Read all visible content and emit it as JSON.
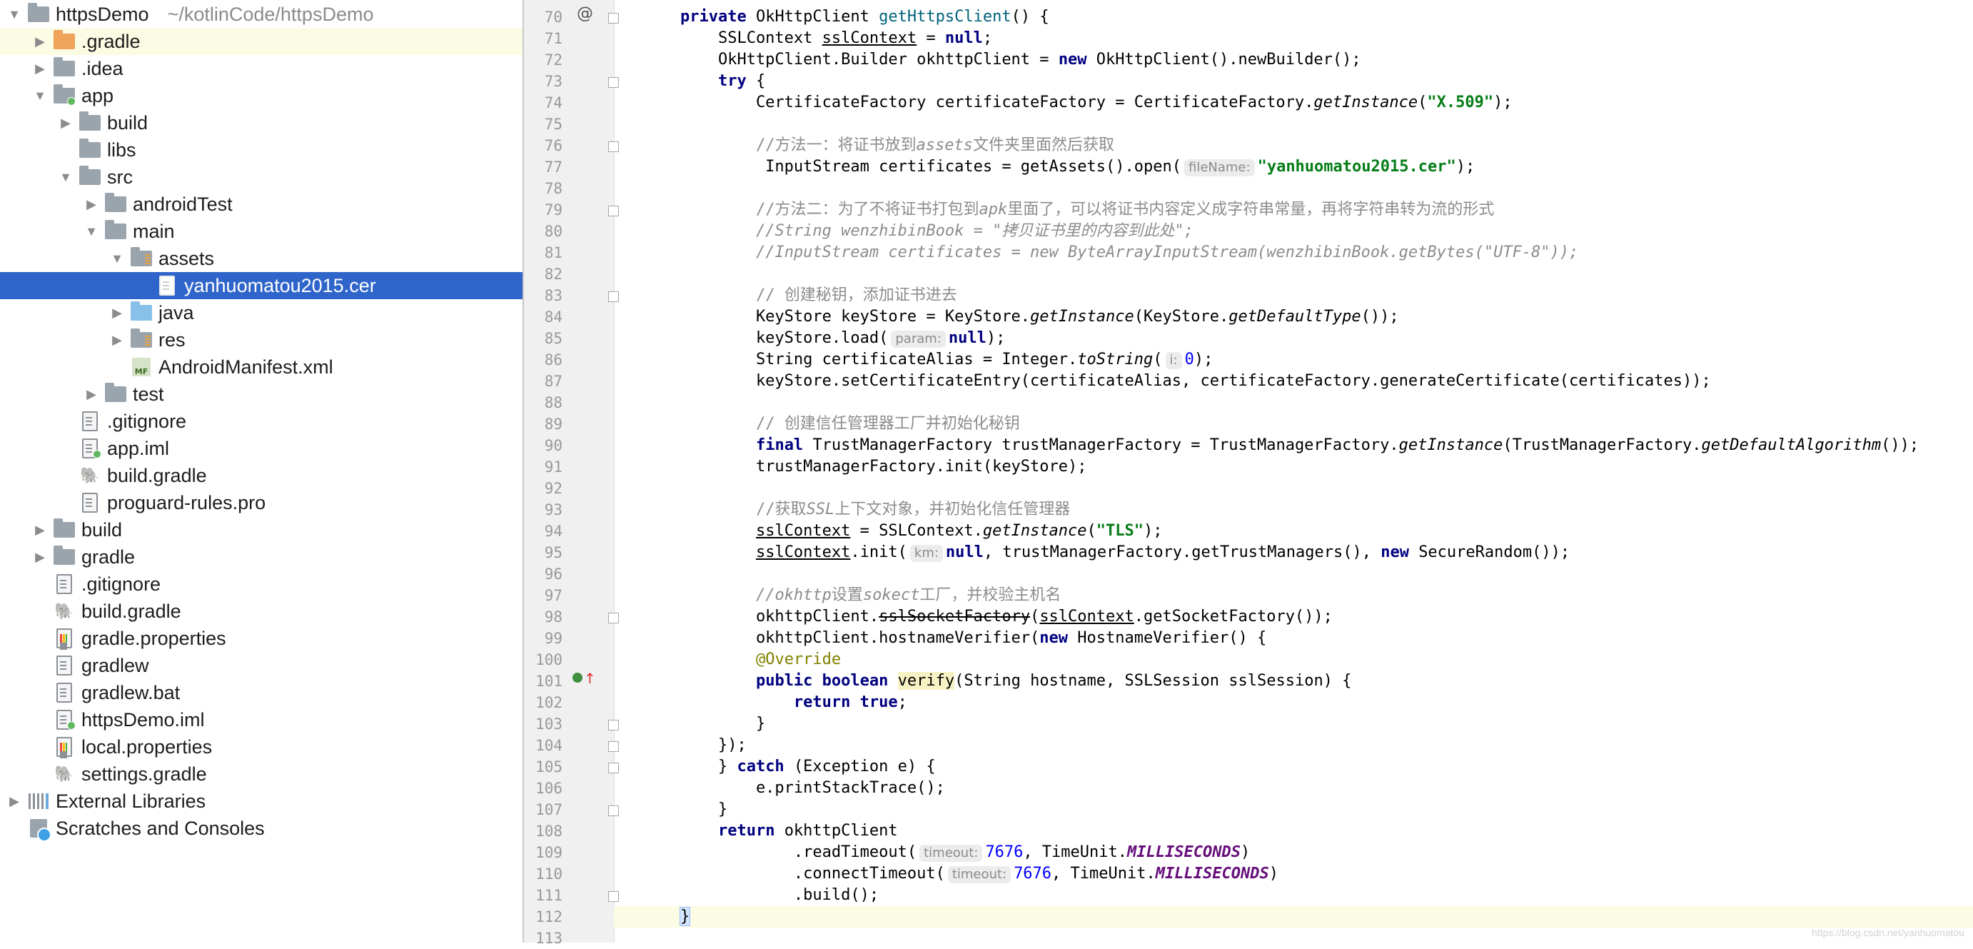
{
  "project": {
    "name": "httpsDemo",
    "path": "~/kotlinCode/httpsDemo"
  },
  "tree": [
    {
      "label": "httpsDemo",
      "indent": 0,
      "arrow": "down",
      "icon": "folder",
      "state": "project-root"
    },
    {
      "label": ".gradle",
      "indent": 1,
      "arrow": "right",
      "icon": "folder-orange",
      "state": "highlight"
    },
    {
      "label": ".idea",
      "indent": 1,
      "arrow": "right",
      "icon": "folder"
    },
    {
      "label": "app",
      "indent": 1,
      "arrow": "down",
      "icon": "module-folder"
    },
    {
      "label": "build",
      "indent": 2,
      "arrow": "right",
      "icon": "folder"
    },
    {
      "label": "libs",
      "indent": 2,
      "arrow": "",
      "icon": "folder"
    },
    {
      "label": "src",
      "indent": 2,
      "arrow": "down",
      "icon": "folder"
    },
    {
      "label": "androidTest",
      "indent": 3,
      "arrow": "right",
      "icon": "folder"
    },
    {
      "label": "main",
      "indent": 3,
      "arrow": "down",
      "icon": "folder"
    },
    {
      "label": "assets",
      "indent": 4,
      "arrow": "down",
      "icon": "folder-res"
    },
    {
      "label": "yanhuomatou2015.cer",
      "indent": 5,
      "arrow": "",
      "icon": "file-white",
      "state": "selected"
    },
    {
      "label": "java",
      "indent": 4,
      "arrow": "right",
      "icon": "folder-blue"
    },
    {
      "label": "res",
      "indent": 4,
      "arrow": "right",
      "icon": "folder-res"
    },
    {
      "label": "AndroidManifest.xml",
      "indent": 4,
      "arrow": "",
      "icon": "manifest"
    },
    {
      "label": "test",
      "indent": 3,
      "arrow": "right",
      "icon": "folder"
    },
    {
      "label": ".gitignore",
      "indent": 2,
      "arrow": "",
      "icon": "file"
    },
    {
      "label": "app.iml",
      "indent": 2,
      "arrow": "",
      "icon": "module-file"
    },
    {
      "label": "build.gradle",
      "indent": 2,
      "arrow": "",
      "icon": "gradle"
    },
    {
      "label": "proguard-rules.pro",
      "indent": 2,
      "arrow": "",
      "icon": "file"
    },
    {
      "label": "build",
      "indent": 1,
      "arrow": "right",
      "icon": "folder"
    },
    {
      "label": "gradle",
      "indent": 1,
      "arrow": "right",
      "icon": "folder"
    },
    {
      "label": ".gitignore",
      "indent": 1,
      "arrow": "",
      "icon": "file"
    },
    {
      "label": "build.gradle",
      "indent": 1,
      "arrow": "",
      "icon": "gradle"
    },
    {
      "label": "gradle.properties",
      "indent": 1,
      "arrow": "",
      "icon": "properties"
    },
    {
      "label": "gradlew",
      "indent": 1,
      "arrow": "",
      "icon": "file"
    },
    {
      "label": "gradlew.bat",
      "indent": 1,
      "arrow": "",
      "icon": "file"
    },
    {
      "label": "httpsDemo.iml",
      "indent": 1,
      "arrow": "",
      "icon": "module-file"
    },
    {
      "label": "local.properties",
      "indent": 1,
      "arrow": "",
      "icon": "properties"
    },
    {
      "label": "settings.gradle",
      "indent": 1,
      "arrow": "",
      "icon": "gradle"
    },
    {
      "label": "External Libraries",
      "indent": 0,
      "arrow": "right",
      "icon": "libraries"
    },
    {
      "label": "Scratches and Consoles",
      "indent": 0,
      "arrow": "",
      "icon": "scratches"
    }
  ],
  "editor": {
    "current_line": 112,
    "line_numbers": [
      "70",
      "71",
      "72",
      "73",
      "74",
      "75",
      "76",
      "77",
      "78",
      "79",
      "80",
      "81",
      "82",
      "83",
      "84",
      "85",
      "86",
      "87",
      "88",
      "89",
      "90",
      "91",
      "92",
      "93",
      "94",
      "95",
      "96",
      "97",
      "98",
      "99",
      "100",
      "101",
      "102",
      "103",
      "104",
      "105",
      "106",
      "107",
      "108",
      "109",
      "110",
      "111",
      "112",
      "113"
    ],
    "lines": [
      [
        [
          "    ",
          ""
        ],
        [
          "private ",
          "kw"
        ],
        [
          "OkHttpClient ",
          ""
        ],
        [
          "getHttpsClient",
          "fn"
        ],
        [
          "() {",
          ""
        ]
      ],
      [
        [
          "        SSLContext ",
          ""
        ],
        [
          "sslContext",
          "ul"
        ],
        [
          " = ",
          ""
        ],
        [
          "null",
          "kw"
        ],
        [
          ";",
          ""
        ]
      ],
      [
        [
          "        OkHttpClient.Builder ",
          ""
        ],
        [
          "okhttpClient",
          ""
        ],
        [
          " = ",
          ""
        ],
        [
          "new ",
          "kw"
        ],
        [
          "OkHttpClient().newBuilder();",
          ""
        ]
      ],
      [
        [
          "        ",
          ""
        ],
        [
          "try ",
          "kw"
        ],
        [
          "{",
          ""
        ]
      ],
      [
        [
          "            CertificateFactory certificateFactory = CertificateFactory.",
          ""
        ],
        [
          "getInstance",
          "it"
        ],
        [
          "(",
          ""
        ],
        [
          "\"X.509\"",
          "str"
        ],
        [
          ");",
          ""
        ]
      ],
      [],
      [
        [
          "            ",
          ""
        ],
        [
          "//方法一：将证书放到",
          "cm"
        ],
        [
          "assets",
          "cmi"
        ],
        [
          "文件夹里面然后获取",
          "cm"
        ]
      ],
      [
        [
          "             InputStream certificates = getAssets().open(",
          ""
        ],
        [
          "fileName:",
          "hint"
        ],
        [
          "\"yanhuomatou2015.cer\"",
          "str"
        ],
        [
          ");",
          ""
        ]
      ],
      [],
      [
        [
          "            ",
          ""
        ],
        [
          "//方法二：为了不将证书打包到",
          "cm"
        ],
        [
          "apk",
          "cmi"
        ],
        [
          "里面了，可以将证书内容定义成字符串常量，再将字符串转为流的形式",
          "cm"
        ]
      ],
      [
        [
          "            ",
          ""
        ],
        [
          "//String wenzhibinBook = \"拷贝证书里的内容到此处\";",
          "cmi"
        ]
      ],
      [
        [
          "            ",
          ""
        ],
        [
          "//InputStream certificates = new ByteArrayInputStream(wenzhibinBook.getBytes(\"UTF-8\"));",
          "cmi"
        ]
      ],
      [],
      [
        [
          "            ",
          ""
        ],
        [
          "// 创建秘钥，添加证书进去",
          "cm"
        ]
      ],
      [
        [
          "            KeyStore keyStore = KeyStore.",
          ""
        ],
        [
          "getInstance",
          "it"
        ],
        [
          "(KeyStore.",
          ""
        ],
        [
          "getDefaultType",
          "it"
        ],
        [
          "());",
          ""
        ]
      ],
      [
        [
          "            keyStore.load(",
          ""
        ],
        [
          "param:",
          "hint"
        ],
        [
          "null",
          "kw"
        ],
        [
          ");",
          ""
        ]
      ],
      [
        [
          "            String certificateAlias = Integer.",
          ""
        ],
        [
          "toString",
          "it"
        ],
        [
          "(",
          ""
        ],
        [
          "i:",
          "hint"
        ],
        [
          "0",
          "num-lit"
        ],
        [
          ");",
          ""
        ]
      ],
      [
        [
          "            keyStore.setCertificateEntry(certificateAlias, certificateFactory.generateCertificate(certificates));",
          ""
        ]
      ],
      [],
      [
        [
          "            ",
          ""
        ],
        [
          "// 创建信任管理器工厂并初始化秘钥",
          "cm"
        ]
      ],
      [
        [
          "            ",
          ""
        ],
        [
          "final ",
          "kw"
        ],
        [
          "TrustManagerFactory trustManagerFactory = TrustManagerFactory.",
          ""
        ],
        [
          "getInstance",
          "it"
        ],
        [
          "(TrustManagerFactory.",
          ""
        ],
        [
          "getDefaultAlgorithm",
          "it"
        ],
        [
          "());",
          ""
        ]
      ],
      [
        [
          "            trustManagerFactory.init(keyStore);",
          ""
        ]
      ],
      [],
      [
        [
          "            ",
          ""
        ],
        [
          "//获取",
          "cm"
        ],
        [
          "SSL",
          "cmi"
        ],
        [
          "上下文对象，并初始化信任管理器",
          "cm"
        ]
      ],
      [
        [
          "            ",
          ""
        ],
        [
          "sslContext",
          "ul"
        ],
        [
          " = SSLContext.",
          ""
        ],
        [
          "getInstance",
          "it"
        ],
        [
          "(",
          ""
        ],
        [
          "\"TLS\"",
          "str"
        ],
        [
          ");",
          ""
        ]
      ],
      [
        [
          "            ",
          ""
        ],
        [
          "sslContext",
          "ul"
        ],
        [
          ".init(",
          ""
        ],
        [
          "km:",
          "hint"
        ],
        [
          "null",
          "kw"
        ],
        [
          ", trustManagerFactory.getTrustManagers(), ",
          ""
        ],
        [
          "new ",
          "kw"
        ],
        [
          "SecureRandom());",
          ""
        ]
      ],
      [],
      [
        [
          "            ",
          ""
        ],
        [
          "//okhttp",
          "cmi"
        ],
        [
          "设置",
          "cm"
        ],
        [
          "sokect",
          "cmi"
        ],
        [
          "工厂，并校验主机名",
          "cm"
        ]
      ],
      [
        [
          "            okhttpClient.",
          ""
        ],
        [
          "sslSocketFactory",
          "strike"
        ],
        [
          "(",
          ""
        ],
        [
          "sslContext",
          "ul"
        ],
        [
          ".getSocketFactory());",
          ""
        ]
      ],
      [
        [
          "            okhttpClient.hostnameVerifier(",
          ""
        ],
        [
          "new ",
          "kw"
        ],
        [
          "HostnameVerifier() {",
          ""
        ]
      ],
      [
        [
          "            ",
          ""
        ],
        [
          "@Override",
          "ann"
        ]
      ],
      [
        [
          "            ",
          ""
        ],
        [
          "public boolean ",
          "kw"
        ],
        [
          "verify",
          "verify-hl"
        ],
        [
          "(String hostname, SSLSession sslSession) {",
          ""
        ]
      ],
      [
        [
          "                ",
          ""
        ],
        [
          "return true",
          "kw"
        ],
        [
          ";",
          ""
        ]
      ],
      [
        [
          "            }",
          ""
        ]
      ],
      [
        [
          "        });",
          ""
        ]
      ],
      [
        [
          "        } ",
          ""
        ],
        [
          "catch ",
          "kw"
        ],
        [
          "(Exception e) {",
          ""
        ]
      ],
      [
        [
          "            e.printStackTrace();",
          ""
        ]
      ],
      [
        [
          "        }",
          ""
        ]
      ],
      [
        [
          "        ",
          ""
        ],
        [
          "return ",
          "kw"
        ],
        [
          "okhttpClient",
          ""
        ]
      ],
      [
        [
          "                .readTimeout(",
          ""
        ],
        [
          "timeout:",
          "hint"
        ],
        [
          "7676",
          "num-lit"
        ],
        [
          ", TimeUnit.",
          ""
        ],
        [
          "MILLISECONDS",
          "cst"
        ],
        [
          ")",
          ""
        ]
      ],
      [
        [
          "                .connectTimeout(",
          ""
        ],
        [
          "timeout:",
          "hint"
        ],
        [
          "7676",
          "num-lit"
        ],
        [
          ", TimeUnit.",
          ""
        ],
        [
          "MILLISECONDS",
          "cst"
        ],
        [
          ")",
          ""
        ]
      ],
      [
        [
          "                .build();",
          ""
        ]
      ],
      [
        [
          "    ",
          ""
        ],
        [
          "}",
          "brace-hl"
        ]
      ],
      []
    ]
  },
  "watermark": "https://blog.csdn.net/yanhuomatou"
}
